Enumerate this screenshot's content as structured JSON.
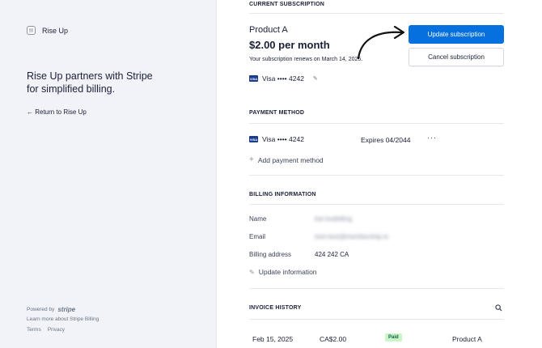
{
  "sidebar": {
    "brand_name": "Rise Up",
    "tagline": "Rise Up partners with Stripe for simplified billing.",
    "return_link": "← Return to Rise Up",
    "powered_by": "Powered by",
    "powered_brand": "stripe",
    "learn_more": "Learn more about Stripe Billing",
    "terms": "Terms",
    "privacy": "Privacy"
  },
  "subscription": {
    "section_title": "CURRENT SUBSCRIPTION",
    "product_name": "Product A",
    "price": "$2.00 per month",
    "renewal_text": "Your subscription renews on March 14, 2025.",
    "card_brand": "VISA",
    "card_text": "Visa •••• 4242",
    "update_button": "Update subscription",
    "cancel_button": "Cancel subscription"
  },
  "payment_method": {
    "section_title": "PAYMENT METHOD",
    "card_brand": "VISA",
    "card_text": "Visa •••• 4242",
    "expires": "Expires 04/2044",
    "more": "···",
    "add_label": "Add payment method"
  },
  "billing": {
    "section_title": "BILLING INFORMATION",
    "name_label": "Name",
    "name_value": "kat testbilling",
    "email_label": "Email",
    "email_value": "test+test@membership.io",
    "address_label": "Billing address",
    "address_value": "424 242 CA",
    "update_label": "Update information"
  },
  "invoices": {
    "section_title": "INVOICE HISTORY",
    "rows": [
      {
        "date": "Feb 15, 2025",
        "amount": "CA$2.00",
        "status": "Paid",
        "product": "Product A"
      }
    ]
  },
  "colors": {
    "accent": "#0570de",
    "paid_bg": "#cbf4c9",
    "sidebar_bg": "#f1f3f8"
  }
}
